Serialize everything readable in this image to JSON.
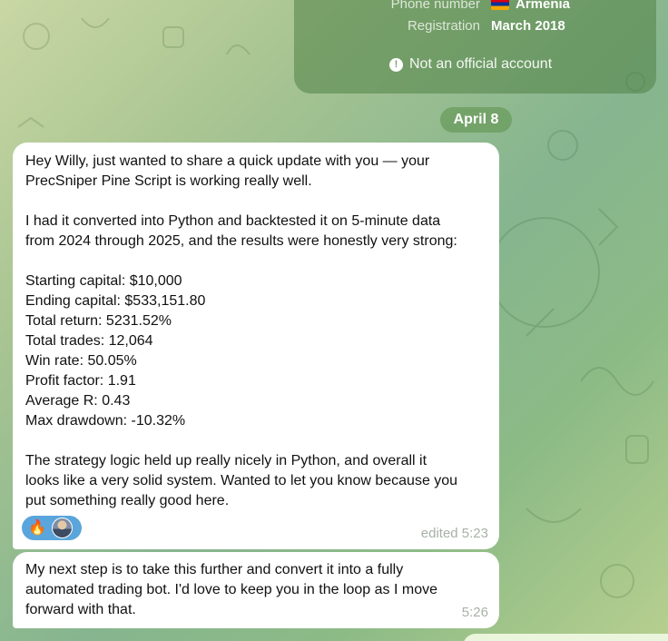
{
  "info_card": {
    "phone_label": "Phone number",
    "phone_value": "Armenia",
    "registration_label": "Registration",
    "registration_value": "March 2018",
    "official_notice": "Not an official account"
  },
  "date_separator": "April 8",
  "messages": [
    {
      "text": "Hey Willy, just wanted to share a quick update with you — your\nPrecSniper Pine Script is working really well.\n\nI had it converted into Python and backtested it on 5-minute data\nfrom 2024 through 2025, and the results were honestly very strong:\n\nStarting capital: $10,000\nEnding capital: $533,151.80\nTotal return: 5231.52%\nTotal trades: 12,064\nWin rate: 50.05%\nProfit factor: 1.91\nAverage R: 0.43\nMax drawdown: -10.32%\n\nThe strategy logic held up really nicely in Python, and overall it\nlooks like a very solid system. Wanted to let you know because you\nput something really good here.",
      "meta": "edited 5:23",
      "reaction": {
        "emoji": "🔥",
        "icon": "fire-icon"
      }
    },
    {
      "text": "My next step is to take this further and convert it into a fully\nautomated trading bot. I'd love to keep you in the loop as I move\nforward with that.",
      "meta": "5:26"
    }
  ]
}
